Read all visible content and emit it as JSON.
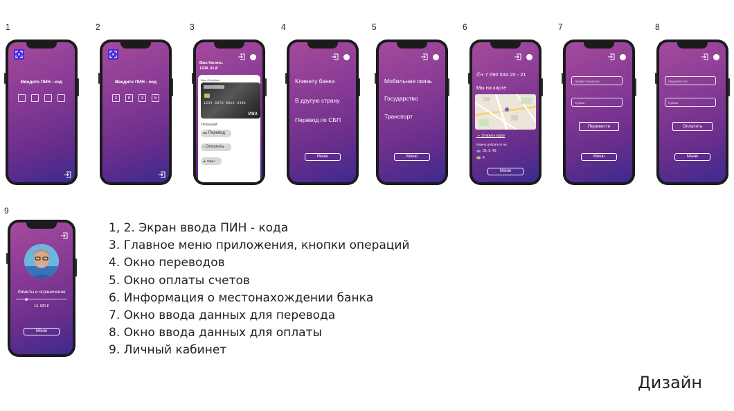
{
  "screens": [
    {
      "number": "1",
      "pin_title": "Введите ПИН - код"
    },
    {
      "number": "2",
      "pin_title": "Введите ПИН - код",
      "pin_digits": [
        "2",
        "8",
        "3",
        "5"
      ]
    },
    {
      "number": "3",
      "balance_label": "Ваш баланс:",
      "balance_value": "1238. 01 ₽",
      "card_label": "Ваш Сбербанк",
      "card_number": "1234 5678 9012 3456",
      "card_brand": "VISA",
      "ops_label": "Операции:",
      "ops": [
        "Перевод",
        "Оплатить",
        "Офис"
      ]
    },
    {
      "number": "4",
      "items": [
        "Клиенту банка",
        "В другую страну",
        "Перевод по СБП"
      ],
      "menu": "Меню"
    },
    {
      "number": "5",
      "items": [
        "Мобильная связь",
        "Государство",
        "Транспорт"
      ],
      "menu": "Меню"
    },
    {
      "number": "6",
      "phone": "+ 7 090 534 20 - 21",
      "map_title": "Мы на карте",
      "open_map": "Открыть карту",
      "reach_label": "Можно добраться на:",
      "bus_routes": "36, 9, 43",
      "tram_routes": "4",
      "menu": "Меню"
    },
    {
      "number": "7",
      "field1": "Номер телефона",
      "field2": "Сумма",
      "action": "Перевести",
      "menu": "Меню"
    },
    {
      "number": "8",
      "field1": "Лицевой счет",
      "field2": "Сумма",
      "action": "Оплатить",
      "menu": "Меню"
    },
    {
      "number": "9",
      "limits_label": "Лимиты и ограничения",
      "limit_value": "13. 920 ₽",
      "limit_fraction": 0.2,
      "menu": "Меню"
    }
  ],
  "legend": [
    "1, 2. Экран ввода ПИН - кода",
    "3. Главное меню приложения, кнопки операций",
    "4. Окно переводов",
    "5. Окно оплаты счетов",
    "6. Информация о местонахождении банка",
    "7. Окно ввода данных для  перевода",
    "8. Окно ввода данных для оплаты",
    "9. Личный кабинет"
  ],
  "design_title": "Дизайн",
  "colors": {
    "accent": "#8a3c96",
    "deep": "#3d2a8e",
    "logo": "#4a2bd6"
  },
  "icons": [
    "exit-icon",
    "logo-icon",
    "bus-icon",
    "tram-icon",
    "car-icon",
    "chip-icon"
  ]
}
